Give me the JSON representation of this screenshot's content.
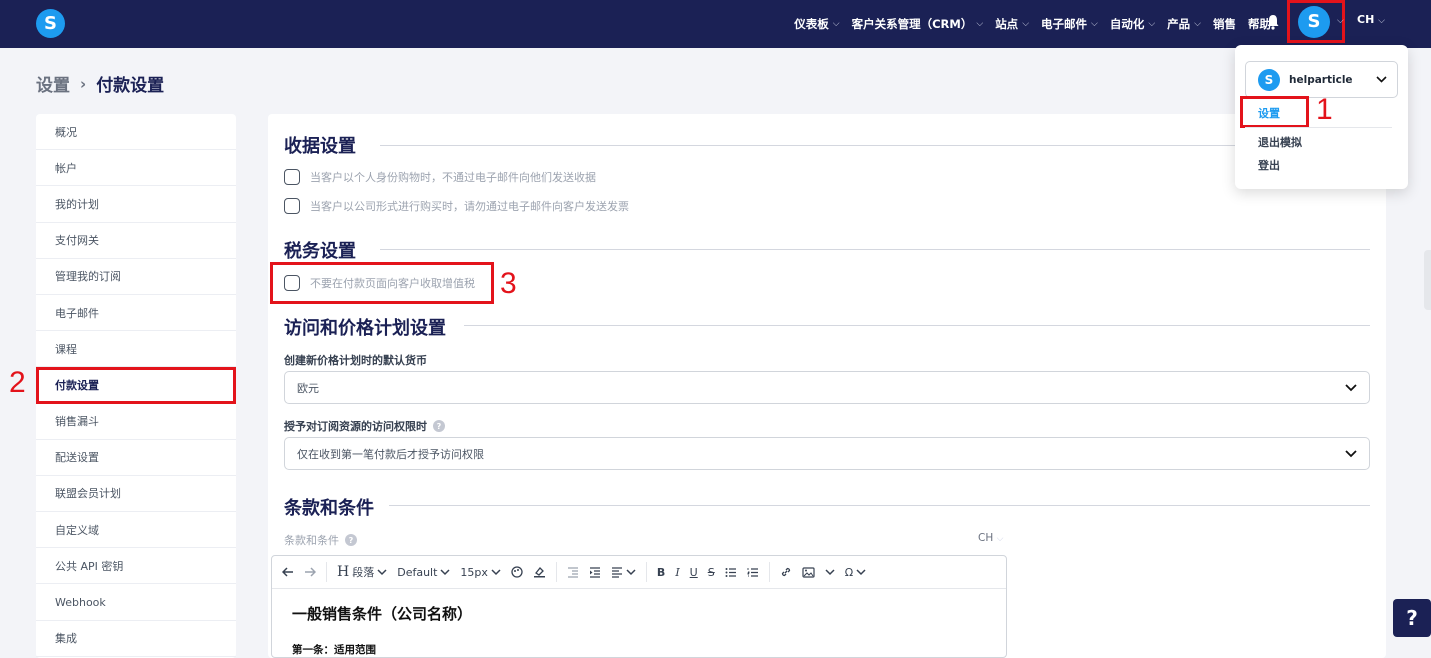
{
  "brand": {
    "logo_letter": "S",
    "accent": "#1d9bf0",
    "nav_bg": "#1b2155",
    "annotation_red": "#e3131b"
  },
  "nav": {
    "items": [
      {
        "label": "仪表板",
        "has_menu": true
      },
      {
        "label": "客户关系管理（CRM）",
        "has_menu": true
      },
      {
        "label": "站点",
        "has_menu": true
      },
      {
        "label": "电子邮件",
        "has_menu": true
      },
      {
        "label": "自动化",
        "has_menu": true
      },
      {
        "label": "产品",
        "has_menu": true
      },
      {
        "label": "销售",
        "has_menu": false
      },
      {
        "label": "帮助",
        "has_menu": false
      }
    ],
    "avatar_letter": "S",
    "language": "CH"
  },
  "breadcrumb": {
    "parent": "设置",
    "current": "付款设置"
  },
  "sidebar": {
    "items": [
      {
        "label": "概况"
      },
      {
        "label": "帐户"
      },
      {
        "label": "我的计划"
      },
      {
        "label": "支付网关"
      },
      {
        "label": "管理我的订阅"
      },
      {
        "label": "电子邮件"
      },
      {
        "label": "课程"
      },
      {
        "label": "付款设置",
        "active": true
      },
      {
        "label": "销售漏斗"
      },
      {
        "label": "配送设置"
      },
      {
        "label": "联盟会员计划"
      },
      {
        "label": "自定义域"
      },
      {
        "label": "公共 API 密钥"
      },
      {
        "label": "Webhook"
      },
      {
        "label": "集成"
      }
    ]
  },
  "main": {
    "receipt": {
      "title": "收据设置",
      "options": [
        "当客户以个人身份购物时，不通过电子邮件向他们发送收据",
        "当客户以公司形式进行购买时，请勿通过电子邮件向客户发送发票"
      ]
    },
    "tax": {
      "title": "税务设置",
      "option": "不要在付款页面向客户收取增值税"
    },
    "access": {
      "title": "访问和价格计划设置",
      "currency_label": "创建新价格计划时的默认货币",
      "currency_value": "欧元",
      "access_label": "授予对订阅资源的访问权限时",
      "access_value": "仅在收到第一笔付款后才授予访问权限"
    },
    "terms": {
      "title": "条款和条件",
      "field_label": "条款和条件",
      "language": "CH",
      "toolbar": {
        "paragraph": "段落",
        "font": "Default",
        "size": "15px"
      },
      "doc_title": "一般销售条件（公司名称）",
      "doc_heading": "第一条：适用范围"
    }
  },
  "account_menu": {
    "account_name": "helparticle",
    "items": [
      {
        "label": "设置",
        "active": true
      },
      {
        "label": "退出模拟"
      },
      {
        "label": "登出"
      }
    ]
  },
  "annotations": {
    "n1": "1",
    "n2": "2",
    "n3": "3"
  },
  "help_fab": "?"
}
